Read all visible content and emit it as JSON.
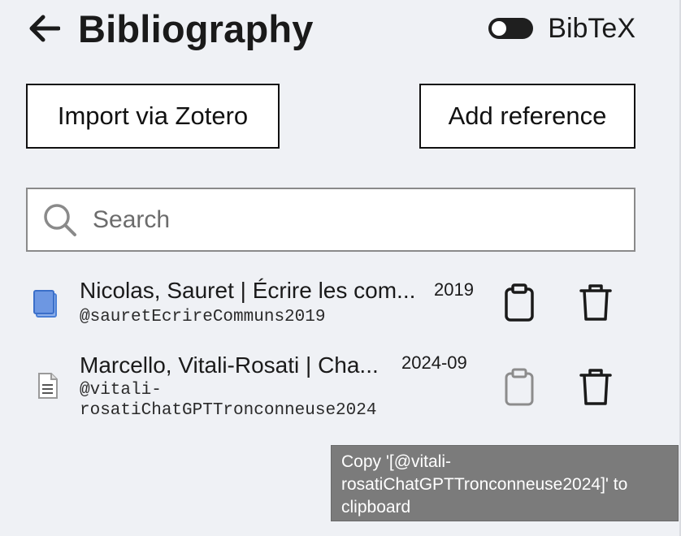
{
  "header": {
    "title": "Bibliography",
    "back_icon": "arrow-left-icon",
    "toggle_label": "BibTeX",
    "toggle_on": false
  },
  "actions": {
    "import_label": "Import via Zotero",
    "add_label": "Add reference"
  },
  "search": {
    "placeholder": "Search",
    "value": ""
  },
  "references": [
    {
      "title": "Nicolas, Sauret | Écrire les com...",
      "key": "@sauretEcrireCommuns2019",
      "year": "2019",
      "type_icon": "book-icon",
      "copy_enabled": true
    },
    {
      "title": "Marcello, Vitali-Rosati | Cha...",
      "key_line1": "@vitali-",
      "key_line2": "rosatiChatGPTTronconneuse2024",
      "year": "2024-09",
      "type_icon": "document-icon",
      "copy_enabled": false
    }
  ],
  "tooltip": {
    "line1": "Copy '[@vitali-",
    "line2": "rosatiChatGPTTronconneuse2024]' to",
    "line3": "clipboard"
  },
  "colors": {
    "background": "#eff1f5",
    "book_icon": "#4a7fd6",
    "tooltip_bg": "#7b7b7b"
  }
}
